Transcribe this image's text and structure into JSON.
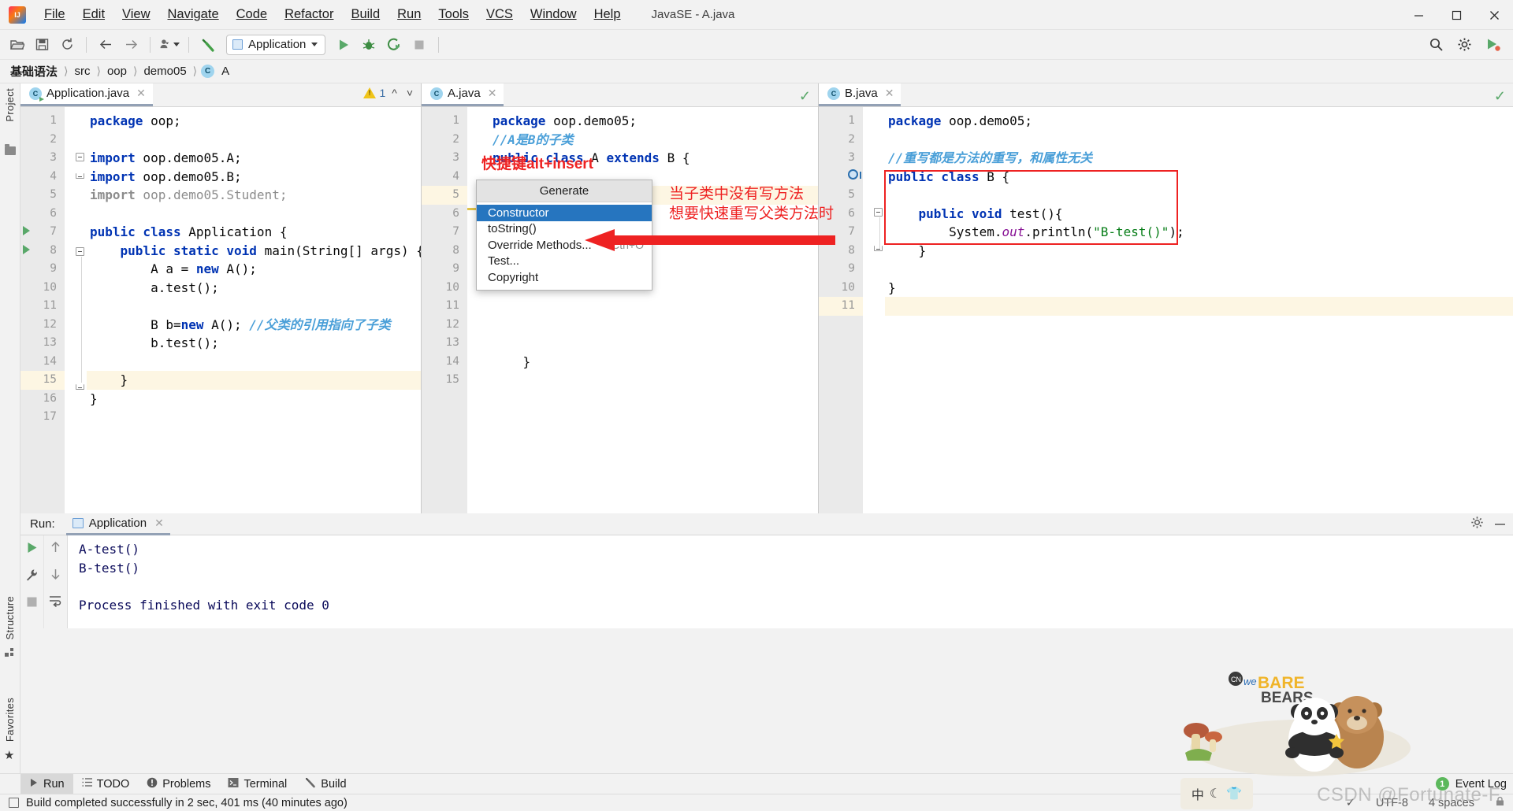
{
  "window": {
    "title": "JavaSE - A.java",
    "minimize_label": "–",
    "maximize_label": "❐",
    "close_label": "✕"
  },
  "menubar": {
    "items": [
      "File",
      "Edit",
      "View",
      "Navigate",
      "Code",
      "Refactor",
      "Build",
      "Run",
      "Tools",
      "VCS",
      "Window",
      "Help"
    ]
  },
  "toolbar": {
    "run_config_label": "Application",
    "icons": [
      "open-folder-icon",
      "save-all-icon",
      "sync-icon",
      "back-arrow-icon",
      "forward-arrow-icon",
      "vcs-update-icon",
      "build-hammer-icon"
    ],
    "right_icons": [
      "search-icon",
      "settings-gear-icon",
      "run-anything-icon"
    ]
  },
  "breadcrumb": {
    "items": [
      "基础语法",
      "src",
      "oop",
      "demo05",
      "A"
    ],
    "class_badge": "C"
  },
  "left_rail": {
    "project_label": "Project",
    "structure_label": "Structure",
    "favorites_label": "Favorites"
  },
  "editors": [
    {
      "tab_label": "Application.java",
      "tab_icon": "java-class-runnable-icon",
      "close_label": "✕",
      "warning_count": "1",
      "lines": [
        {
          "n": "1",
          "html": "<span class='kw'>package</span><span class='plain'> oop;</span>"
        },
        {
          "n": "2",
          "html": ""
        },
        {
          "n": "3",
          "html": "<span class='kw'>import</span><span class='plain'> oop.demo05.A;</span>"
        },
        {
          "n": "4",
          "html": "<span class='kw'>import</span><span class='plain'> oop.demo05.B;</span>"
        },
        {
          "n": "5",
          "html": "<span class='grey' style='font-weight:bold'>import</span><span class='grey'> oop.demo05.Student;</span>"
        },
        {
          "n": "6",
          "html": ""
        },
        {
          "n": "7",
          "html": "<span class='kw'>public class </span><span class='plain'>Application {</span>"
        },
        {
          "n": "8",
          "html": "<span class='plain'>    </span><span class='kw'>public static void </span><span class='plain'>main(String[] args) {</span>"
        },
        {
          "n": "9",
          "html": "<span class='plain'>        A a = </span><span class='kw'>new </span><span class='plain'>A();</span>"
        },
        {
          "n": "10",
          "html": "<span class='plain'>        a.test();</span>"
        },
        {
          "n": "11",
          "html": ""
        },
        {
          "n": "12",
          "html": "<span class='plain'>        B b=</span><span class='kw'>new </span><span class='plain'>A(); </span><span class='cmt'>//父类的引用指向了子类</span>"
        },
        {
          "n": "13",
          "html": "<span class='plain'>        b.test();</span>"
        },
        {
          "n": "14",
          "html": ""
        },
        {
          "n": "15",
          "html": "<span class='plain'>    }</span>",
          "highlight": true
        },
        {
          "n": "16",
          "html": "<span class='plain'>}</span>"
        },
        {
          "n": "17",
          "html": ""
        }
      ]
    },
    {
      "tab_label": "A.java",
      "tab_icon": "java-class-icon",
      "close_label": "✕",
      "status": "ok-check-icon",
      "lines": [
        {
          "n": "1",
          "html": "<span class='kw'>package</span><span class='plain'> oop.demo05;</span>"
        },
        {
          "n": "2",
          "html": "<span class='cmt'>//A是B的子类</span>"
        },
        {
          "n": "3",
          "html": "<span class='kw'>public class </span><span class='plain'>A </span><span class='kw'>extends </span><span class='plain'>B {</span>"
        },
        {
          "n": "4",
          "html": ""
        },
        {
          "n": "5",
          "html": "",
          "highlight": true
        },
        {
          "n": "6",
          "html": ""
        },
        {
          "n": "7",
          "html": ""
        },
        {
          "n": "8",
          "html": ""
        },
        {
          "n": "9",
          "html": ""
        },
        {
          "n": "10",
          "html": ""
        },
        {
          "n": "11",
          "html": ""
        },
        {
          "n": "12",
          "html": ""
        },
        {
          "n": "13",
          "html": ""
        },
        {
          "n": "14",
          "html": "<span class='plain'>    }</span>"
        },
        {
          "n": "15",
          "html": ""
        }
      ]
    },
    {
      "tab_label": "B.java",
      "tab_icon": "java-class-icon",
      "close_label": "✕",
      "status": "ok-check-icon",
      "lines": [
        {
          "n": "1",
          "html": "<span class='kw'>package</span><span class='plain'> oop.demo05;</span>"
        },
        {
          "n": "2",
          "html": ""
        },
        {
          "n": "3",
          "html": "<span class='cmt'>//重写都是方法的重写，和属性无关</span>"
        },
        {
          "n": "4",
          "html": "<span class='kw'>public class </span><span class='plain'>B {</span>"
        },
        {
          "n": "5",
          "html": ""
        },
        {
          "n": "6",
          "html": "<span class='plain'>    </span><span class='kw'>public void </span><span class='plain'>test(){</span>"
        },
        {
          "n": "7",
          "html": "<span class='plain'>        System.</span><span class='fld'>out</span><span class='plain'>.println(</span><span class='str'>\"B-test()\"</span><span class='plain'>);</span>"
        },
        {
          "n": "8",
          "html": "<span class='plain'>    }</span>"
        },
        {
          "n": "9",
          "html": ""
        },
        {
          "n": "10",
          "html": "<span class='plain'>}</span>"
        },
        {
          "n": "11",
          "html": "",
          "highlight": true
        }
      ]
    }
  ],
  "generate_popup": {
    "title": "Generate",
    "items": [
      {
        "label": "Constructor",
        "shortcut": "",
        "selected": true
      },
      {
        "label": "toString()",
        "shortcut": "",
        "selected": false
      },
      {
        "label": "Override Methods...",
        "shortcut": "Ctrl+O",
        "selected": false
      },
      {
        "label": "Test...",
        "shortcut": "",
        "selected": false
      },
      {
        "label": "Copyright",
        "shortcut": "",
        "selected": false
      }
    ]
  },
  "annotations": {
    "shortcut_hint": "快捷键alt+insert",
    "chinese_note_line1": "当子类中没有写方法",
    "chinese_note_line2": "想要快速重写父类方法时",
    "accent_color": "#ee2222"
  },
  "run_panel": {
    "label": "Run:",
    "tab_label": "Application",
    "close_label": "✕",
    "console_lines": [
      "A-test()",
      "B-test()",
      "",
      "Process finished with exit code 0"
    ],
    "side_icons": [
      "rerun-play-icon",
      "settings-wrench-icon",
      "stop-icon",
      "up-arrow-icon",
      "down-arrow-icon",
      "soft-wrap-icon"
    ],
    "header_icons": [
      "settings-gear-icon",
      "hide-minimize-icon"
    ]
  },
  "toolwindow_bar": {
    "items": [
      {
        "label": "Run",
        "icon": "play-icon",
        "active": true
      },
      {
        "label": "TODO",
        "icon": "list-icon",
        "active": false
      },
      {
        "label": "Problems",
        "icon": "exclamation-circle-icon",
        "active": false
      },
      {
        "label": "Terminal",
        "icon": "terminal-icon",
        "active": false
      },
      {
        "label": "Build",
        "icon": "hammer-icon",
        "active": false
      }
    ],
    "event_log_label": "Event Log",
    "event_log_count": "1"
  },
  "statusbar": {
    "message": "Build completed successfully in 2 sec, 401 ms (40 minutes ago)",
    "encoding": "UTF-8",
    "indent": "4 spaces",
    "line_sep": "✓"
  },
  "watermark": {
    "text": "CSDN @Fortunate-F",
    "bears_label": "we BARE BEARS",
    "ime_chars": "中"
  }
}
